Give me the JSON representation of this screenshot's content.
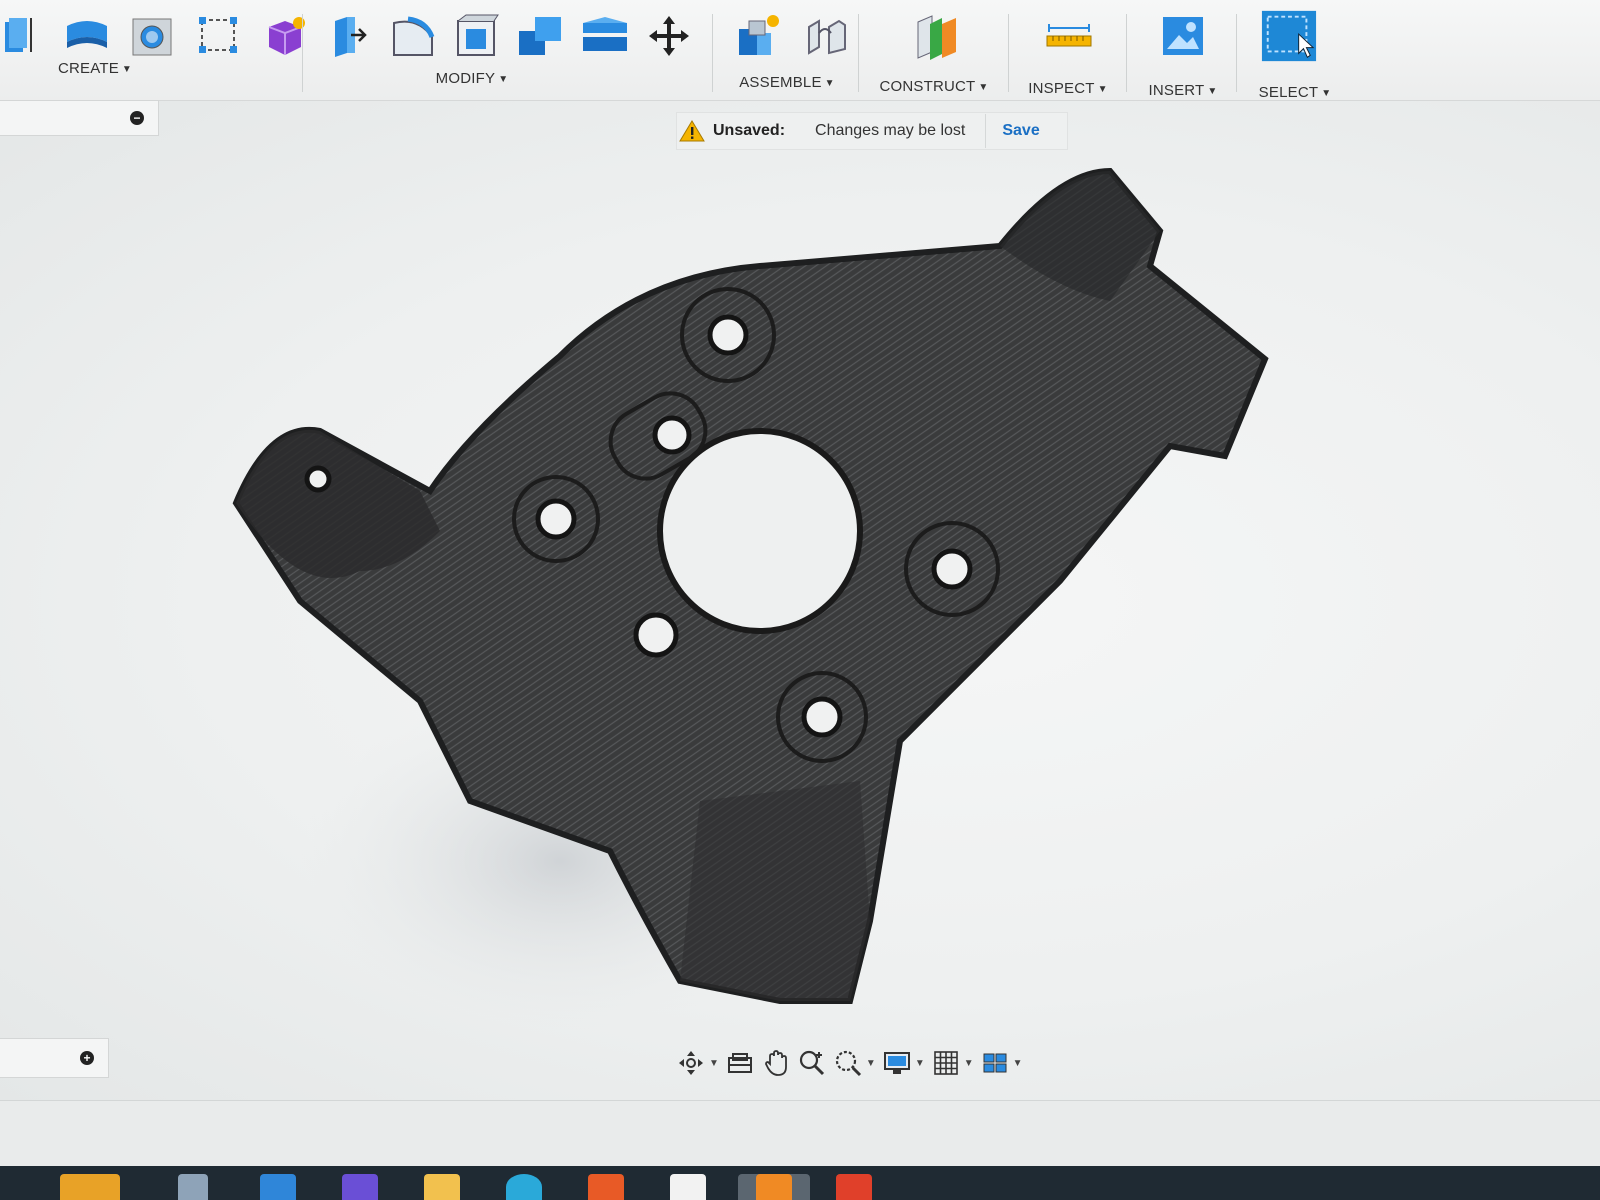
{
  "toolbar": {
    "groups": [
      {
        "label": "CREATE"
      },
      {
        "label": "MODIFY"
      },
      {
        "label": "ASSEMBLE"
      },
      {
        "label": "CONSTRUCT"
      },
      {
        "label": "INSPECT"
      },
      {
        "label": "INSERT"
      },
      {
        "label": "SELECT"
      }
    ],
    "create_tools": [
      "extrude-icon",
      "revolve-icon",
      "hole-icon",
      "sketch-dimension-icon",
      "form-icon"
    ],
    "modify_tools": [
      "press-pull-icon",
      "fillet-icon",
      "shell-icon",
      "combine-icon",
      "split-body-icon",
      "move-icon"
    ],
    "assemble_tools": [
      "new-component-icon",
      "joint-icon"
    ],
    "construct_tools": [
      "offset-plane-icon"
    ],
    "inspect_tools": [
      "measure-icon"
    ],
    "insert_tools": [
      "insert-image-icon"
    ],
    "select_tools": [
      "select-window-icon"
    ],
    "accent_color": "#1e88d6"
  },
  "notice": {
    "status": "Unsaved:",
    "message": "Changes may be lost",
    "action": "Save",
    "warning_icon": "warning-icon"
  },
  "browser": {
    "top_toggle": "minus",
    "bottom_toggle": "plus"
  },
  "navbar": {
    "tools": [
      "orbit-icon",
      "look-at-icon",
      "pan-icon",
      "zoom-icon",
      "fit-icon",
      "display-settings-icon",
      "grid-icon",
      "viewports-icon"
    ]
  },
  "taskbar": {
    "apps": [
      "file-explorer-icon",
      "task-view-icon",
      "mail-icon",
      "copilot-icon",
      "folder-icon",
      "edge-icon",
      "brave-icon",
      "app-icon",
      "fusion-icon",
      "app-red-icon"
    ]
  }
}
